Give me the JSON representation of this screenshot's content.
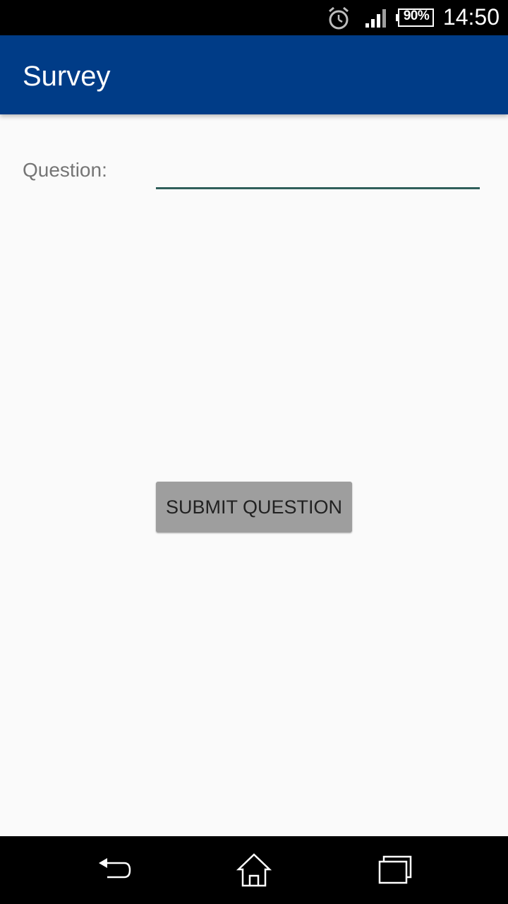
{
  "status_bar": {
    "battery": "90%",
    "time": "14:50",
    "icons": [
      "alarm-icon",
      "signal-icon",
      "battery-icon"
    ]
  },
  "app_bar": {
    "title": "Survey",
    "color": "#003c87"
  },
  "form": {
    "question_label": "Question:",
    "question_value": "",
    "submit_label": "SUBMIT QUESTION"
  },
  "nav_bar": {
    "icons": [
      "back-icon",
      "home-icon",
      "recent-apps-icon"
    ]
  }
}
